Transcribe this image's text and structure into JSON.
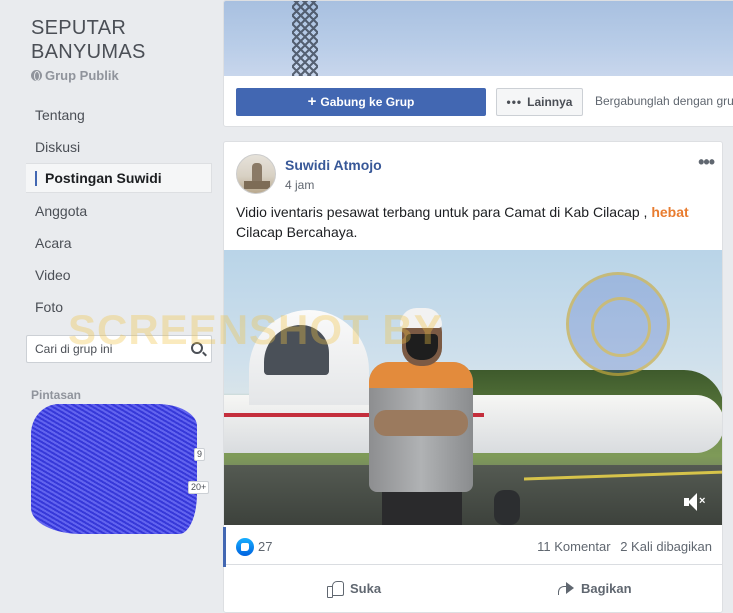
{
  "sidebar": {
    "group_title_line1": "SEPUTAR",
    "group_title_line2": "BANYUMAS",
    "group_type": "Grup Publik",
    "nav": [
      {
        "label": "Tentang"
      },
      {
        "label": "Diskusi"
      },
      {
        "label": "Postingan Suwidi",
        "active": true
      },
      {
        "label": "Anggota"
      },
      {
        "label": "Acara"
      },
      {
        "label": "Video"
      },
      {
        "label": "Foto"
      }
    ],
    "search_placeholder": "Cari di grup ini",
    "shortcuts_label": "Pintasan",
    "shortcut_badges": [
      "9",
      "20+"
    ]
  },
  "top_card": {
    "join_label": "Gabung ke Grup",
    "more_label": "Lainnya",
    "join_hint": "Bergabunglah dengan gru"
  },
  "post": {
    "author": "Suwidi Atmojo",
    "time": "4 jam",
    "text_before": "Vidio iventaris pesawat terbang untuk para Camat di Kab Cilacap ,",
    "text_highlight": "hebat",
    "text_after": "Cilacap Bercahaya.",
    "like_count": "27",
    "comments": "11 Komentar",
    "shares": "2 Kali dibagikan",
    "like_label": "Suka",
    "share_label": "Bagikan"
  },
  "watermark": {
    "text": "SCREENSHOT BY"
  },
  "colors": {
    "accent": "#4267b2",
    "link": "#385898",
    "highlight": "#e87c2f",
    "background": "#e9ebee"
  },
  "icons": {
    "globe": "globe-icon",
    "search": "search-icon",
    "plus": "plus-icon",
    "more": "more-dots-icon",
    "post_menu": "ellipsis-icon",
    "like_reaction": "like-reaction-icon",
    "like_action": "thumbs-up-icon",
    "share_action": "share-arrow-icon",
    "mute": "mute-icon"
  }
}
